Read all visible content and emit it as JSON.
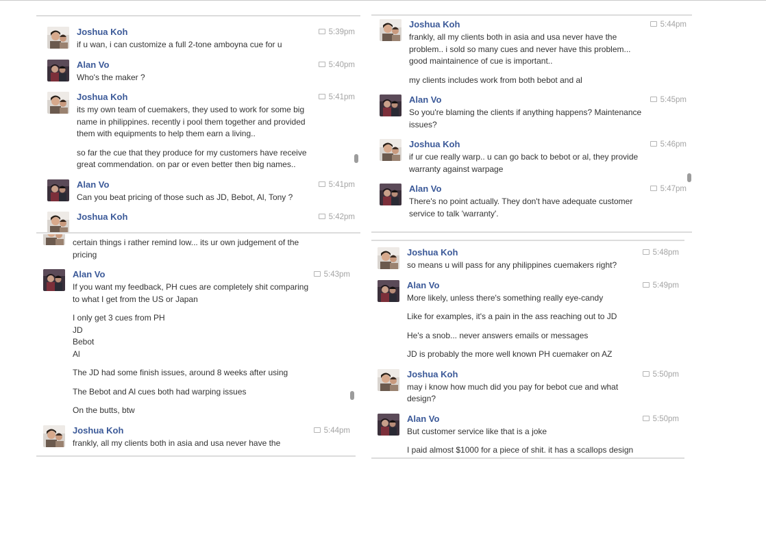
{
  "panels": [
    {
      "messages": [
        {
          "sender": "Joshua Koh",
          "avatar": "joshua-avatar",
          "time": "5:39pm",
          "paragraphs": [
            [
              "if u wan, i can customize a full 2-tone amboyna cue for u"
            ]
          ]
        },
        {
          "sender": "Alan Vo",
          "avatar": "alan-avatar",
          "time": "5:40pm",
          "paragraphs": [
            [
              "Who's the maker ?"
            ]
          ]
        },
        {
          "sender": "Joshua Koh",
          "avatar": "joshua-avatar",
          "time": "5:41pm",
          "paragraphs": [
            [
              "its my own team of cuemakers, they used to work for some big",
              "name in philippines. recently i pool them together and provided",
              "them with equipments to help them earn a living.."
            ],
            [
              "so far the cue that they produce for my customers have receive",
              "great commendation. on par or even better then big names.."
            ]
          ]
        },
        {
          "sender": "Alan Vo",
          "avatar": "alan-avatar",
          "time": "5:41pm",
          "paragraphs": [
            [
              "Can you beat pricing of those such as JD, Bebot, Al, Tony ?"
            ]
          ]
        },
        {
          "sender": "Joshua Koh",
          "avatar": "joshua-avatar",
          "time": "5:42pm",
          "paragraphs": []
        }
      ]
    },
    {
      "messages": [
        {
          "sender": "",
          "avatar": "joshua-avatar",
          "time": "",
          "paragraphs": [
            [
              "certain things i rather remind low... its ur own judgement of the",
              "pricing"
            ]
          ]
        },
        {
          "sender": "Alan Vo",
          "avatar": "alan-avatar",
          "time": "5:43pm",
          "paragraphs": [
            [
              "If you want my feedback, PH cues are completely shit comparing",
              "to what I get from the US or Japan"
            ],
            [
              "I only get 3 cues from PH",
              "JD",
              "Bebot",
              "Al"
            ],
            [
              "The JD had some finish issues, around 8 weeks after using"
            ],
            [
              "The Bebot and Al cues both had warping issues"
            ],
            [
              "On the butts, btw"
            ]
          ]
        },
        {
          "sender": "Joshua Koh",
          "avatar": "joshua-avatar",
          "time": "5:44pm",
          "paragraphs": [
            [
              "frankly, all my clients both in asia and usa never have the"
            ]
          ]
        }
      ]
    },
    {
      "messages": [
        {
          "sender": "Joshua Koh",
          "avatar": "joshua-avatar",
          "time": "5:44pm",
          "paragraphs": [
            [
              "frankly, all my clients both in asia and usa never have the",
              "problem.. i sold so many cues and never have this problem...",
              "good maintainence of cue is important.."
            ],
            [
              "my clients includes work from both bebot and al"
            ]
          ]
        },
        {
          "sender": "Alan Vo",
          "avatar": "alan-avatar",
          "time": "5:45pm",
          "paragraphs": [
            [
              "So you're blaming the clients if anything happens? Maintenance",
              "issues?"
            ]
          ]
        },
        {
          "sender": "Joshua Koh",
          "avatar": "joshua-avatar",
          "time": "5:46pm",
          "paragraphs": [
            [
              "if ur cue really warp.. u can go back to bebot or al, they provide",
              "warranty against warpage"
            ]
          ]
        },
        {
          "sender": "Alan Vo",
          "avatar": "alan-avatar",
          "time": "5:47pm",
          "paragraphs": [
            [
              "There's no point actually. They don't have adequate customer",
              "service to talk 'warranty'."
            ]
          ]
        }
      ]
    },
    {
      "messages": [
        {
          "sender": "Joshua Koh",
          "avatar": "joshua-avatar",
          "time": "5:48pm",
          "paragraphs": [
            [
              "so means u will pass for any philippines cuemakers right?"
            ]
          ]
        },
        {
          "sender": "Alan Vo",
          "avatar": "alan-avatar",
          "time": "5:49pm",
          "paragraphs": [
            [
              "More likely, unless there's something really eye-candy"
            ],
            [
              "Like for examples, it's a pain in the ass reaching out to JD"
            ],
            [
              "He's a snob... never answers emails or messages"
            ],
            [
              "JD is probably the more well known PH cuemaker on AZ"
            ]
          ]
        },
        {
          "sender": "Joshua Koh",
          "avatar": "joshua-avatar",
          "time": "5:50pm",
          "paragraphs": [
            [
              "may i know how much did you pay for bebot cue and what",
              "design?"
            ]
          ]
        },
        {
          "sender": "Alan Vo",
          "avatar": "alan-avatar",
          "time": "5:50pm",
          "paragraphs": [
            [
              "But customer service like that is a joke"
            ],
            [
              "I paid almost $1000 for a piece of shit. it has a scallops design"
            ]
          ]
        }
      ]
    }
  ],
  "colors": {
    "name": "#3b5998",
    "text": "#333333",
    "time": "#a4a4a4"
  }
}
